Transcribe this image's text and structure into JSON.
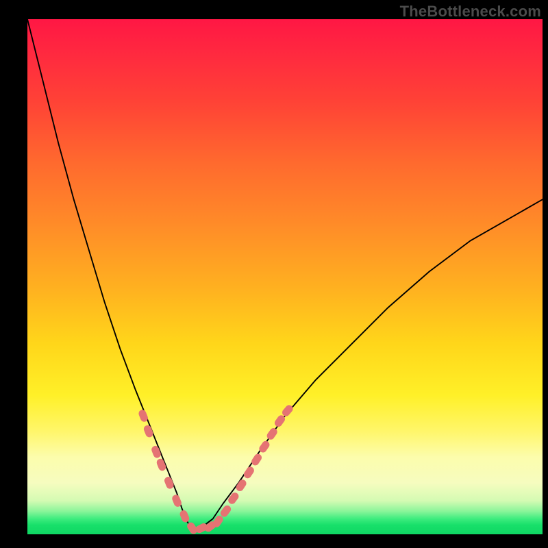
{
  "watermark": "TheBottleneck.com",
  "colors": {
    "marker": "#e57373",
    "curve": "#000000",
    "gradient_top": "#ff1744",
    "gradient_mid": "#ffd61a",
    "gradient_bottom": "#0fd763",
    "frame": "#000000"
  },
  "chart_data": {
    "type": "line",
    "title": "",
    "xlabel": "",
    "ylabel": "",
    "xlim": [
      0,
      100
    ],
    "ylim": [
      0,
      100
    ],
    "description": "Asymmetric V-shaped bottleneck curve on a red→yellow→green vertical gradient. Minimum (≈0) near x≈32. Left branch rises steeply toward 100 at x→0; right branch rises more gently toward ≈65 at x=100. Salmon-colored capsule markers cluster along the lower parts of both branches and across the trough.",
    "series": [
      {
        "name": "bottleneck-curve",
        "x": [
          0,
          3,
          6,
          9,
          12,
          15,
          18,
          21,
          23,
          25,
          27,
          29,
          30,
          31,
          32,
          33,
          34,
          36,
          38,
          41,
          45,
          50,
          56,
          62,
          70,
          78,
          86,
          93,
          100
        ],
        "y": [
          100,
          88,
          76,
          65,
          55,
          45,
          36,
          28,
          23,
          18,
          13,
          8,
          5,
          2.5,
          1,
          1,
          1.5,
          3,
          6,
          10,
          16,
          23,
          30,
          36,
          44,
          51,
          57,
          61,
          65
        ]
      }
    ],
    "markers": {
      "name": "highlight-markers",
      "shape": "capsule",
      "color": "#e57373",
      "points": [
        {
          "x": 22.5,
          "y": 23
        },
        {
          "x": 23.5,
          "y": 20
        },
        {
          "x": 25,
          "y": 16
        },
        {
          "x": 26,
          "y": 13.5
        },
        {
          "x": 27.5,
          "y": 10
        },
        {
          "x": 29,
          "y": 6.5
        },
        {
          "x": 30.5,
          "y": 3.5
        },
        {
          "x": 32,
          "y": 1.2
        },
        {
          "x": 33.8,
          "y": 1.2
        },
        {
          "x": 35.5,
          "y": 1.5
        },
        {
          "x": 37,
          "y": 2.5
        },
        {
          "x": 38.5,
          "y": 4.5
        },
        {
          "x": 40,
          "y": 7
        },
        {
          "x": 41.5,
          "y": 9.5
        },
        {
          "x": 43,
          "y": 12
        },
        {
          "x": 44.5,
          "y": 14.5
        },
        {
          "x": 46,
          "y": 17
        },
        {
          "x": 47.5,
          "y": 19.5
        },
        {
          "x": 49,
          "y": 22
        },
        {
          "x": 50.5,
          "y": 24
        }
      ]
    }
  }
}
